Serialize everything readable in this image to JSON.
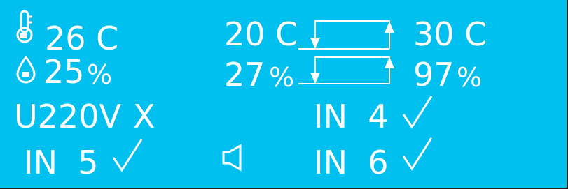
{
  "colors": {
    "background": "#00c0f0",
    "foreground": "#ffffff",
    "outline": "#222222"
  },
  "icons": {
    "temperature": "thermometer-icon",
    "humidity": "water-drop-icon",
    "sound": "speaker-icon",
    "ok": "check-icon",
    "range_min": "arrow-down-icon",
    "range_max": "arrow-up-icon"
  },
  "temperature": {
    "current": "26 C",
    "min": "20 C",
    "max": "30 C"
  },
  "humidity": {
    "current_value": "25",
    "current_unit": "%",
    "min_value": "27",
    "min_unit": "%",
    "max_value": "97",
    "max_unit": "%"
  },
  "power": {
    "label": "U220V",
    "status": "X"
  },
  "inputs": [
    {
      "label": "IN  4",
      "status": "ok"
    },
    {
      "label": "IN  5",
      "status": "ok"
    },
    {
      "label": "IN  6",
      "status": "ok"
    }
  ]
}
